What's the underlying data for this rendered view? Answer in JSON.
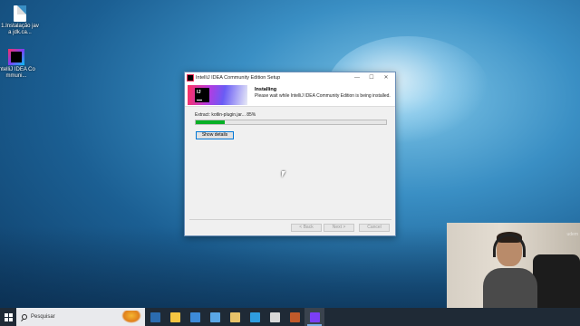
{
  "desktop": {
    "icons": [
      {
        "label": "1.Instalação java jdk.ca...",
        "icon": "document-icon"
      },
      {
        "label": "IntelliJ IDEA Communi...",
        "icon": "intellij-icon"
      }
    ]
  },
  "window": {
    "title": "IntelliJ IDEA Community Edition Setup",
    "controls": {
      "minimize": "—",
      "maximize": "☐",
      "close": "✕"
    },
    "header": {
      "heading": "Installing",
      "description": "Please wait while IntelliJ IDEA Community Edition is being installed.",
      "logo_text": "IJ"
    },
    "status_text": "Extract: kotlin-plugin.jar... 85%",
    "progress_fraction": 0.15,
    "show_details_label": "Show details",
    "back_label": "< Back",
    "next_label": "Next >",
    "cancel_label": "Cancel"
  },
  "webcam": {
    "watermark": "udem"
  },
  "taskbar": {
    "search_placeholder": "Pesquisar",
    "icons": [
      {
        "name": "task-view-icon",
        "color": "#2b6cb0"
      },
      {
        "name": "file-explorer-icon",
        "color": "#f4c542"
      },
      {
        "name": "store-icon",
        "color": "#3d8bd9"
      },
      {
        "name": "camera-app-icon",
        "color": "#5aa7e6"
      },
      {
        "name": "paint-icon",
        "color": "#e8c36a"
      },
      {
        "name": "edge-icon",
        "color": "#2f9de0"
      },
      {
        "name": "terminal-icon",
        "color": "#d8d8d8"
      },
      {
        "name": "game-app-icon",
        "color": "#c05a2a"
      },
      {
        "name": "intellij-icon",
        "color": "#7b3ef5"
      }
    ]
  }
}
